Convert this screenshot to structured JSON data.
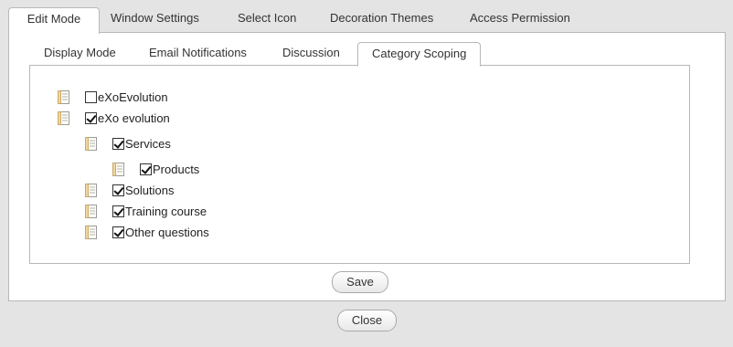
{
  "outer_tabs": [
    {
      "label": "Edit Mode",
      "active": true
    },
    {
      "label": "Window Settings",
      "active": false
    },
    {
      "label": "Select Icon",
      "active": false
    },
    {
      "label": "Decoration Themes",
      "active": false
    },
    {
      "label": "Access Permission",
      "active": false
    }
  ],
  "inner_tabs": [
    {
      "label": "Display Mode",
      "active": false
    },
    {
      "label": "Email Notifications",
      "active": false
    },
    {
      "label": "Discussion",
      "active": false
    },
    {
      "label": "Category Scoping",
      "active": true
    }
  ],
  "tree": [
    {
      "label": "eXoEvolution",
      "checked": false,
      "level": 0
    },
    {
      "label": "eXo evolution",
      "checked": true,
      "level": 0
    },
    {
      "label": "Services",
      "checked": true,
      "level": 1
    },
    {
      "label": "Products",
      "checked": true,
      "level": 2
    },
    {
      "label": "Solutions",
      "checked": true,
      "level": 1
    },
    {
      "label": "Training course",
      "checked": true,
      "level": 1
    },
    {
      "label": "Other questions",
      "checked": true,
      "level": 1
    }
  ],
  "buttons": {
    "save_label": "Save",
    "close_label": "Close"
  },
  "icons": {
    "tree_node": "category-node-icon",
    "checkbox": "checkbox"
  }
}
